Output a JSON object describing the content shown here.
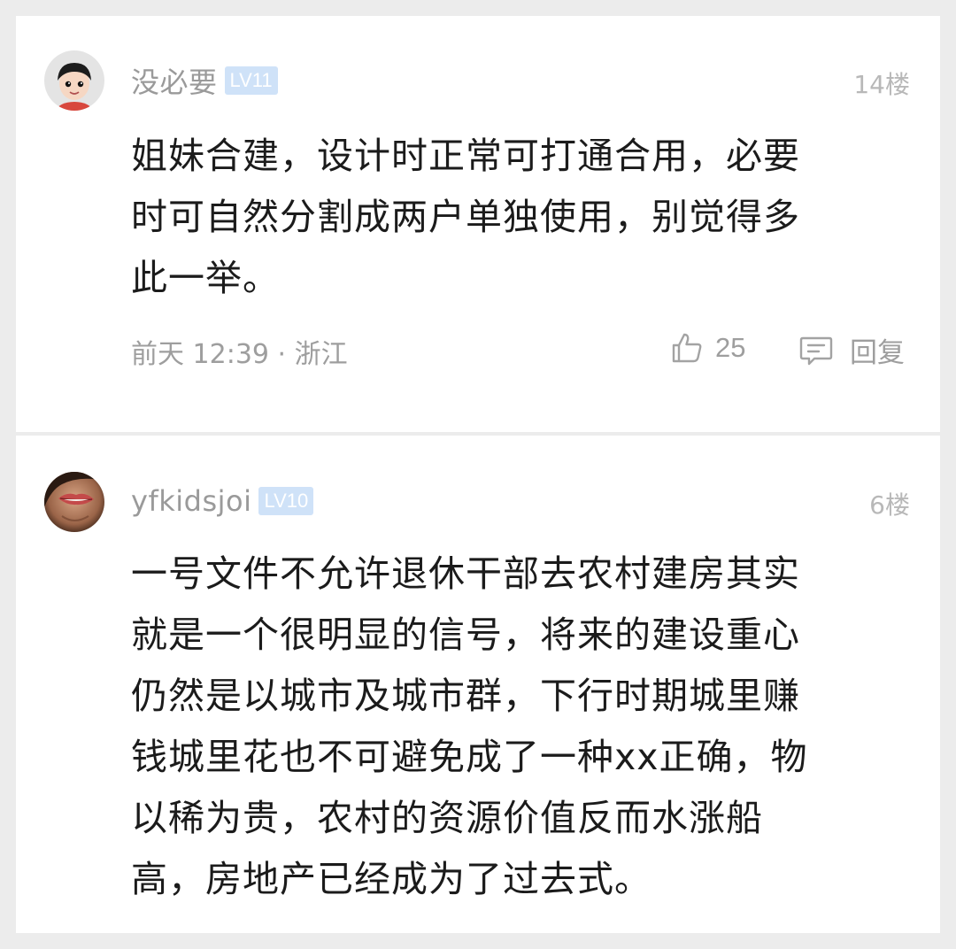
{
  "comments": [
    {
      "username": "没必要",
      "level": "LV11",
      "floor": "14楼",
      "avatar_icon": "cartoon-avatar-icon",
      "content": "姐妹合建，设计时正常可打通合用，必要\n时可自然分割成两户单独使用，别觉得多\n此一举。",
      "meta": "前天 12:39 · 浙江",
      "likes": "25",
      "reply_label": "回复"
    },
    {
      "username": "yfkidsjoi",
      "level": "LV10",
      "floor": "6楼",
      "avatar_icon": "lips-photo-avatar-icon",
      "content": "一号文件不允许退休干部去农村建房其实\n就是一个很明显的信号，将来的建设重心\n仍然是以城市及城市群，下行时期城里赚\n钱城里花也不可避免成了一种xx正确，物\n以稀为贵，农村的资源价值反而水涨船\n高，房地产已经成为了过去式。"
    }
  ],
  "colors": {
    "background": "#ececec",
    "card": "#ffffff",
    "badge": "#cfe2f8",
    "muted_text": "#9e9e9e"
  }
}
